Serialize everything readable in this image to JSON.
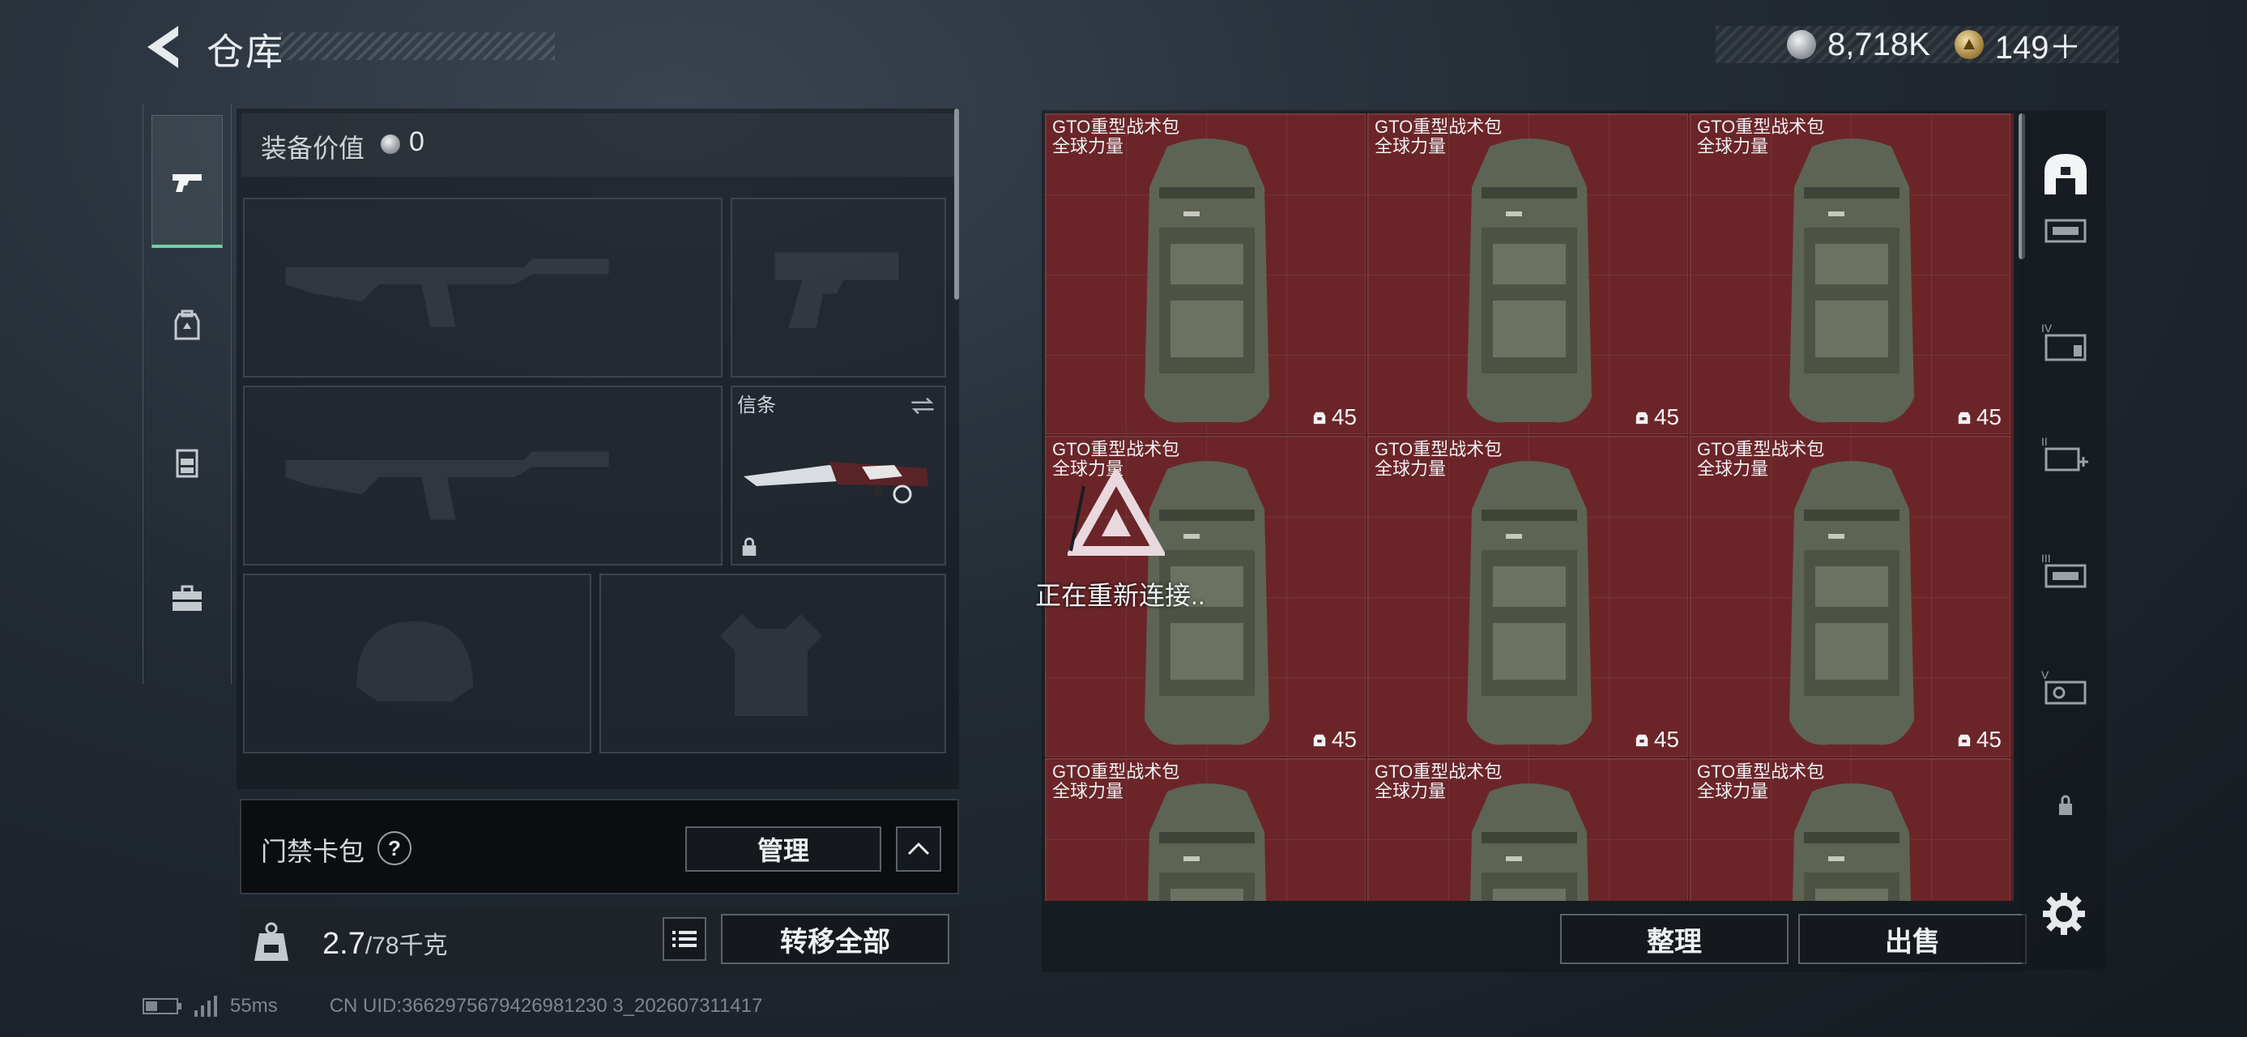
{
  "header": {
    "title": "仓库",
    "currencies": [
      {
        "icon": "silver-coin-icon",
        "value": "8,718K"
      },
      {
        "icon": "gold-coin-icon",
        "value": "149＋"
      }
    ]
  },
  "sidebar": {
    "items": [
      {
        "name": "pistol-icon",
        "active": true
      },
      {
        "name": "backpack-icon",
        "active": false
      },
      {
        "name": "vest-icon",
        "active": false
      },
      {
        "name": "toolbox-icon",
        "active": false
      }
    ]
  },
  "equipment": {
    "value_label": "装备价值",
    "value": "0",
    "melee_label": "信条"
  },
  "keycard": {
    "label": "门禁卡包",
    "help": "?",
    "manage": "管理"
  },
  "weight": {
    "current": "2.7",
    "capacity": "/78千克",
    "transfer_all": "转移全部"
  },
  "status": {
    "ping": "55ms",
    "uid": "CN UID:3662975679426981230 3_202607311417"
  },
  "storage": {
    "items": [
      {
        "name": "GTO重型战术包",
        "sub": "全球力量",
        "qty": "45"
      },
      {
        "name": "GTO重型战术包",
        "sub": "全球力量",
        "qty": "45"
      },
      {
        "name": "GTO重型战术包",
        "sub": "全球力量",
        "qty": "45"
      },
      {
        "name": "GTO重型战术包",
        "sub": "全球力量",
        "qty": "45"
      },
      {
        "name": "GTO重型战术包",
        "sub": "全球力量",
        "qty": "45"
      },
      {
        "name": "GTO重型战术包",
        "sub": "全球力量",
        "qty": "45"
      },
      {
        "name": "GTO重型战术包",
        "sub": "全球力量",
        "qty": ""
      },
      {
        "name": "GTO重型战术包",
        "sub": "全球力量",
        "qty": ""
      },
      {
        "name": "GTO重型战术包",
        "sub": "全球力量",
        "qty": ""
      }
    ],
    "item_color": "#6b2528",
    "sort": "整理",
    "sell": "出售"
  },
  "overlay": {
    "reconnect": "正在重新连接.."
  },
  "right_tabs": [
    {
      "name": "storage-home-icon",
      "active": true
    },
    {
      "name": "storage-tier-2-icon"
    },
    {
      "name": "storage-tier-4-icon"
    },
    {
      "name": "storage-tier-2-plus-icon"
    },
    {
      "name": "storage-tier-3-icon"
    },
    {
      "name": "storage-tier-5-icon"
    },
    {
      "name": "lock-icon"
    }
  ]
}
